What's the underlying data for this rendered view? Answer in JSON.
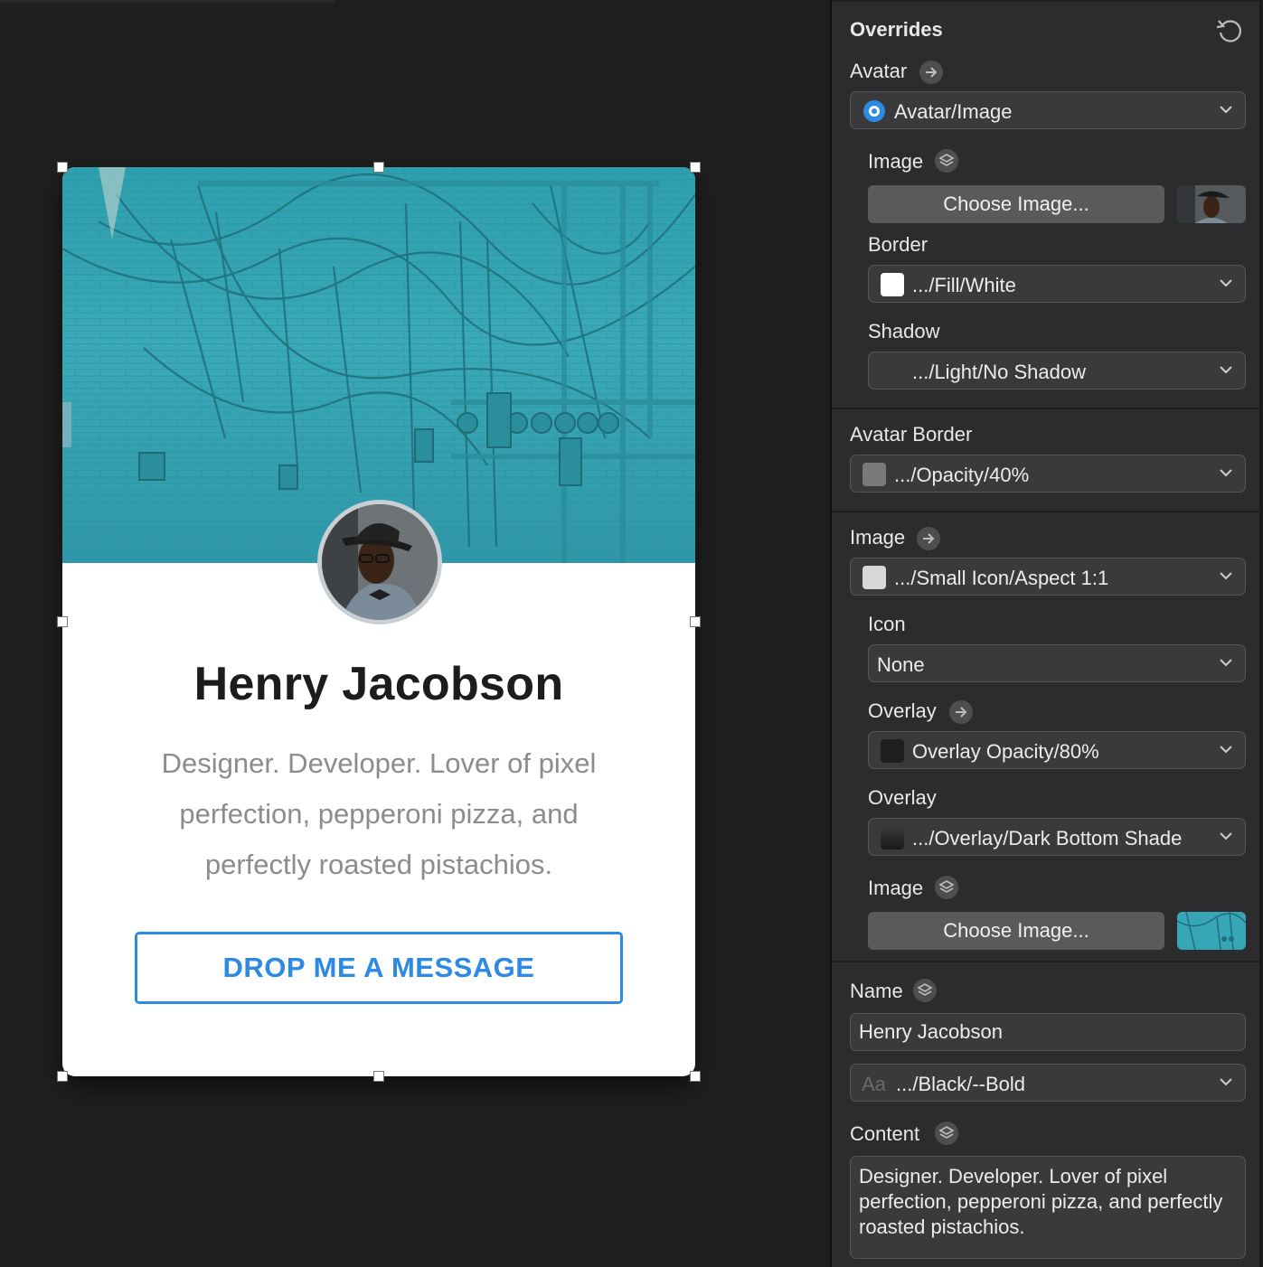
{
  "card": {
    "name": "Henry Jacobson",
    "bio": "Designer. Developer. Lover of pixel perfection, pepperoni pizza, and perfectly roasted pistachios.",
    "button_label": "DROP ME A MESSAGE"
  },
  "panel": {
    "title": "Overrides",
    "avatar": {
      "label": "Avatar",
      "symbol": "Avatar/Image",
      "image_label": "Image",
      "choose_image": "Choose Image...",
      "border_label": "Border",
      "border_value": ".../Fill/White",
      "shadow_label": "Shadow",
      "shadow_value": ".../Light/No Shadow"
    },
    "avatar_border": {
      "label": "Avatar Border",
      "value": ".../Opacity/40%"
    },
    "image": {
      "label": "Image",
      "symbol": ".../Small Icon/Aspect 1:1",
      "icon_label": "Icon",
      "icon_value": "None",
      "overlay1_label": "Overlay",
      "overlay1_value": "Overlay Opacity/80%",
      "overlay2_label": "Overlay",
      "overlay2_value": ".../Overlay/Dark Bottom Shade",
      "image_label": "Image",
      "choose_image": "Choose Image..."
    },
    "name": {
      "label": "Name",
      "value": "Henry Jacobson",
      "style_prefix": "Aa",
      "style_value": ".../Black/--Bold"
    },
    "content": {
      "label": "Content",
      "value": "Designer. Developer. Lover of pixel perfection, pepperoni pizza, and perfectly roasted pistachios."
    }
  },
  "colors": {
    "accent_blue": "#2d8ae2",
    "canvas_bg": "#1f1f1f",
    "panel_bg": "#2c2c2e",
    "cover_teal": "#3aa9b8"
  },
  "icons": {
    "reset": "reset-icon",
    "arrow": "arrow-right-icon",
    "layers": "layers-icon",
    "chevron": "chevron-down-icon"
  }
}
